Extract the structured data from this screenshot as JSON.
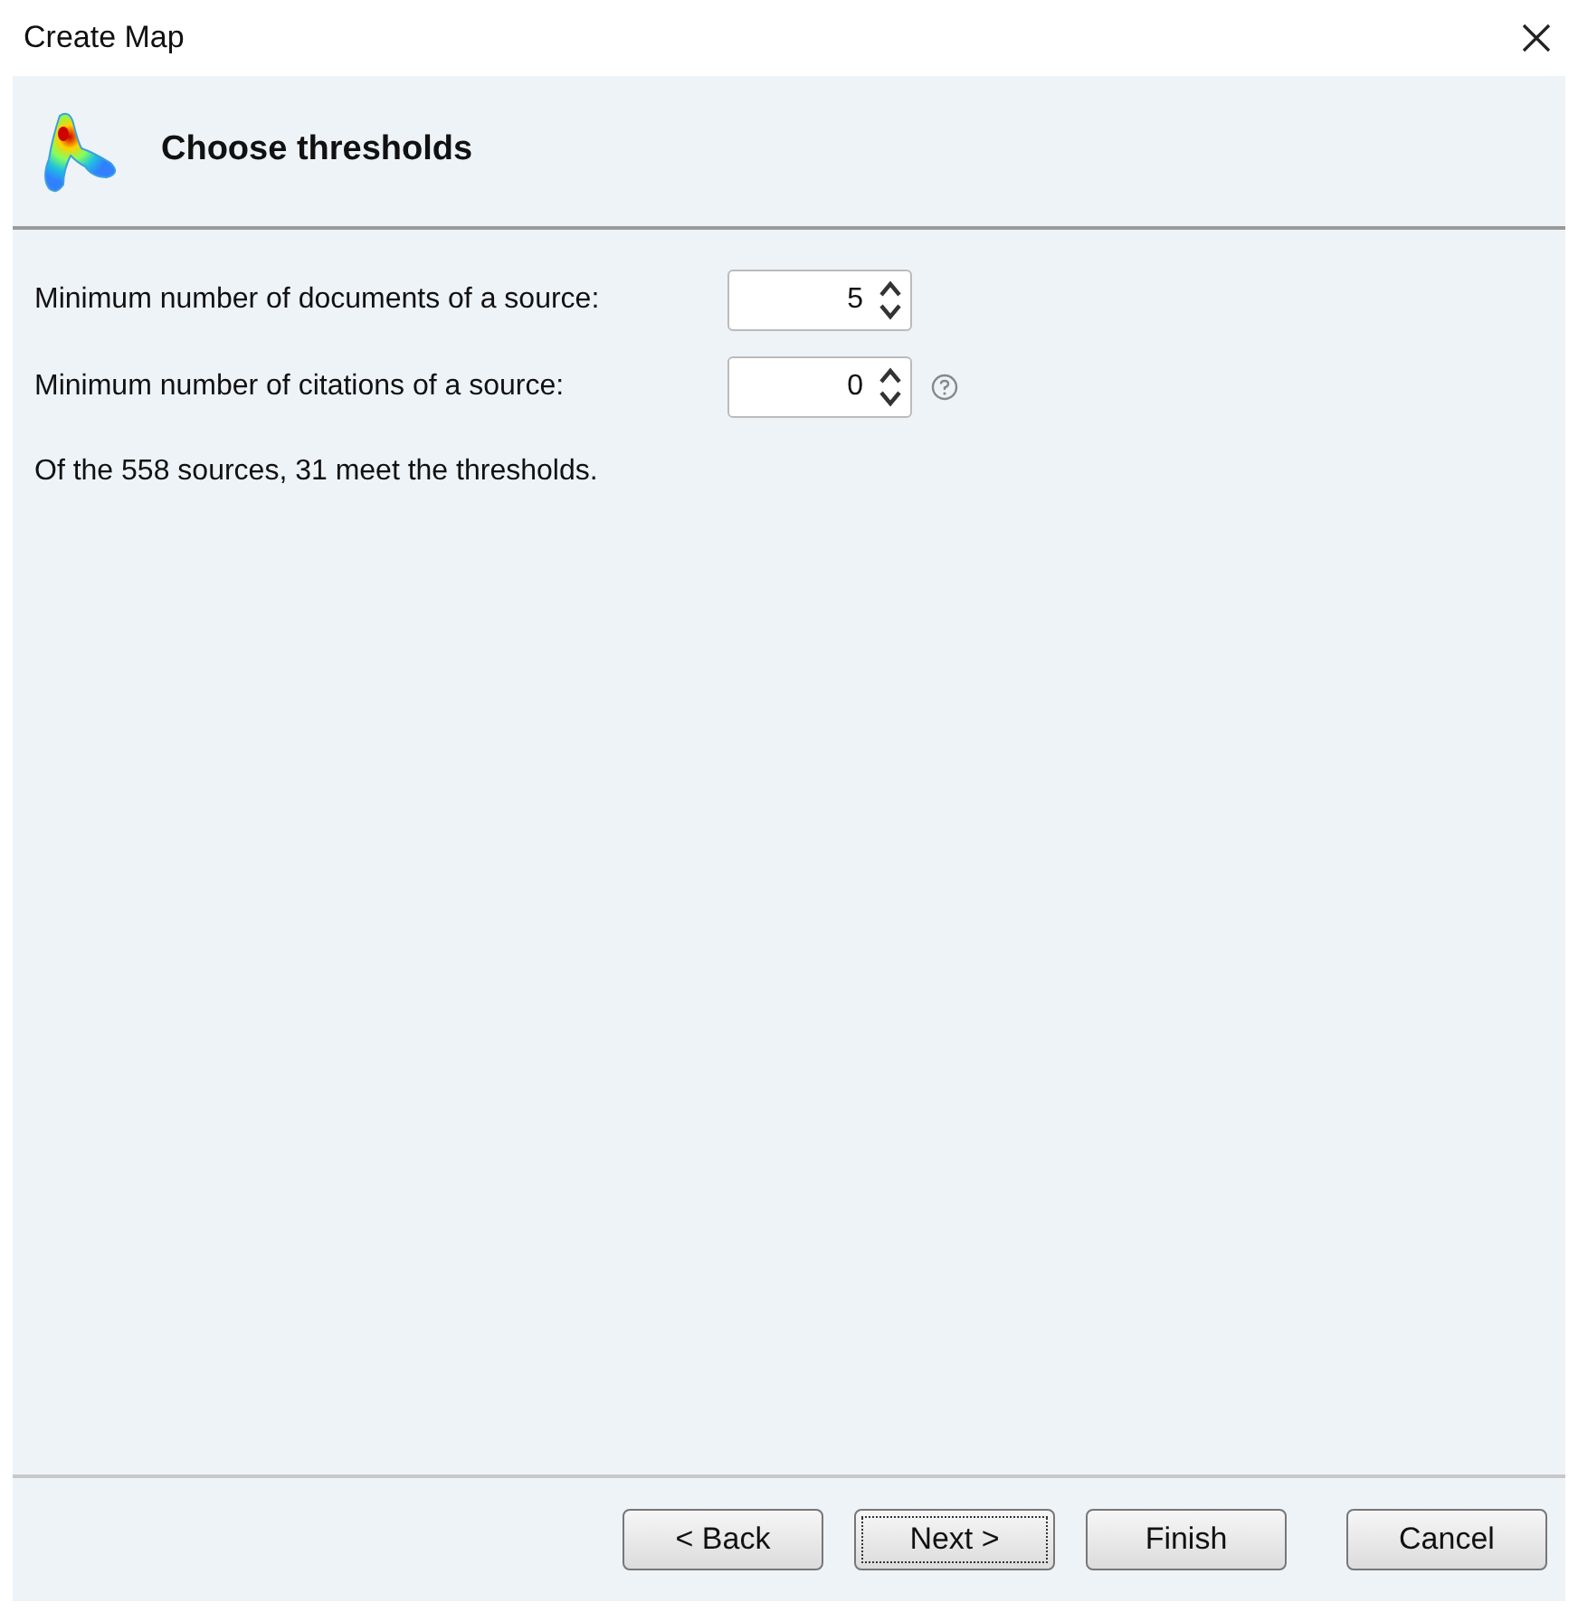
{
  "window": {
    "title": "Create Map"
  },
  "header": {
    "title": "Choose thresholds"
  },
  "fields": [
    {
      "label": "Minimum number of documents of a source:",
      "value": "5",
      "help": false
    },
    {
      "label": "Minimum number of citations of a source:",
      "value": "0",
      "help": true
    }
  ],
  "summary": "Of the 558 sources, 31 meet the thresholds.",
  "buttons": [
    {
      "label": "< Back",
      "focused": false
    },
    {
      "label": "Next >",
      "focused": true
    },
    {
      "label": "Finish",
      "focused": false
    },
    {
      "label": "Cancel",
      "focused": false
    }
  ]
}
